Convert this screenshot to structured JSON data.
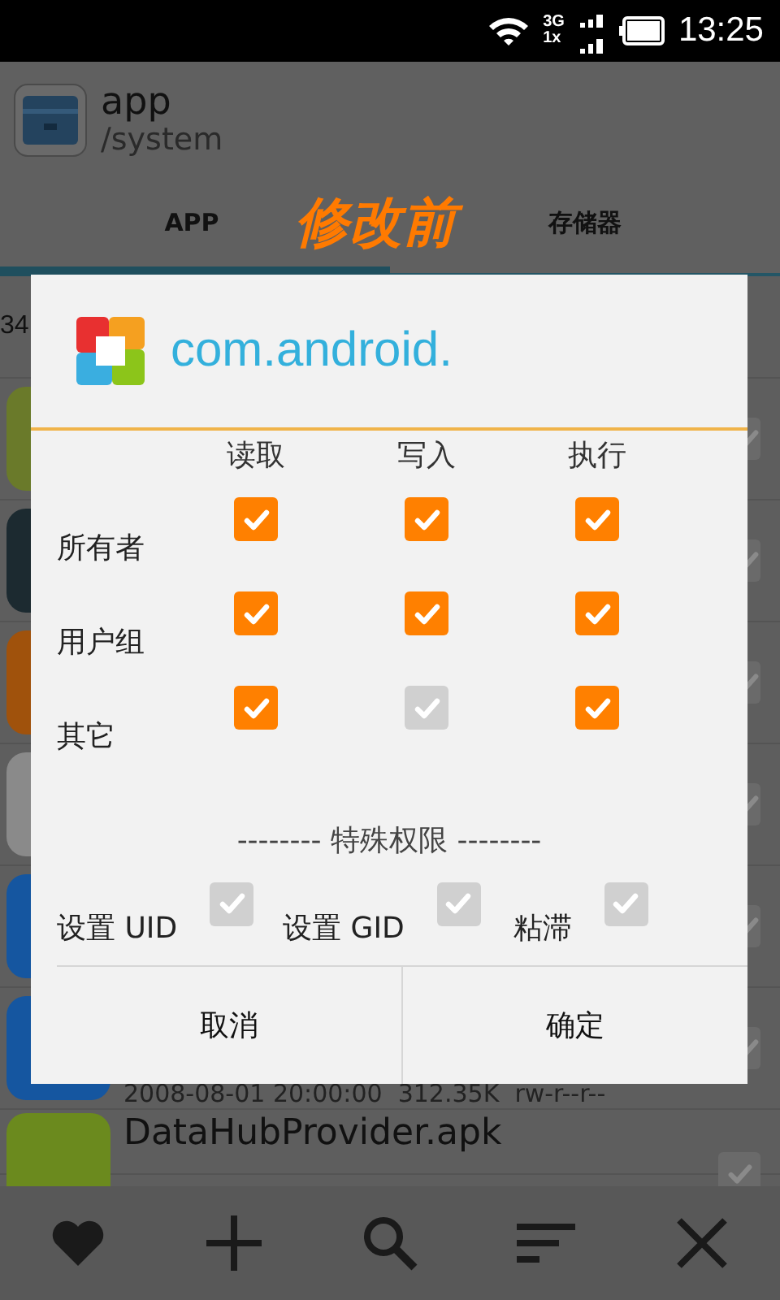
{
  "status_bar": {
    "network_top": "3G",
    "network_bottom": "1x",
    "time": "13:25"
  },
  "header": {
    "title": "app",
    "path": "/system"
  },
  "tabs": [
    {
      "label": "APP",
      "selected": true
    },
    {
      "label": "存储器",
      "selected": false
    }
  ],
  "annotation": "修改前",
  "list": {
    "summary": "34",
    "rows": [
      {
        "checked": false
      },
      {
        "checked": false
      },
      {
        "checked": false
      },
      {
        "checked": false
      },
      {
        "checked": false
      },
      {
        "subtitle": "2008-08-01 20:00:00  312.35K  rw-r--r--",
        "checked": false
      },
      {
        "title": "DataHubProvider.apk",
        "checked": false
      }
    ]
  },
  "dialog": {
    "title": "com.android.",
    "columns": [
      "读取",
      "写入",
      "执行"
    ],
    "rows": [
      {
        "label": "所有者",
        "checks": [
          {
            "checked": true
          },
          {
            "checked": true
          },
          {
            "checked": true
          }
        ]
      },
      {
        "label": "用户组",
        "checks": [
          {
            "checked": true
          },
          {
            "checked": true
          },
          {
            "checked": true
          }
        ]
      },
      {
        "label": "其它",
        "checks": [
          {
            "checked": true
          },
          {
            "checked": false
          },
          {
            "checked": true
          }
        ]
      }
    ],
    "special_heading": "-------- 特殊权限 --------",
    "special": [
      {
        "label": "设置 UID",
        "checked": false
      },
      {
        "label": "设置 GID",
        "checked": false
      },
      {
        "label": "粘滞",
        "checked": false
      }
    ],
    "buttons": [
      "取消",
      "确定"
    ]
  }
}
